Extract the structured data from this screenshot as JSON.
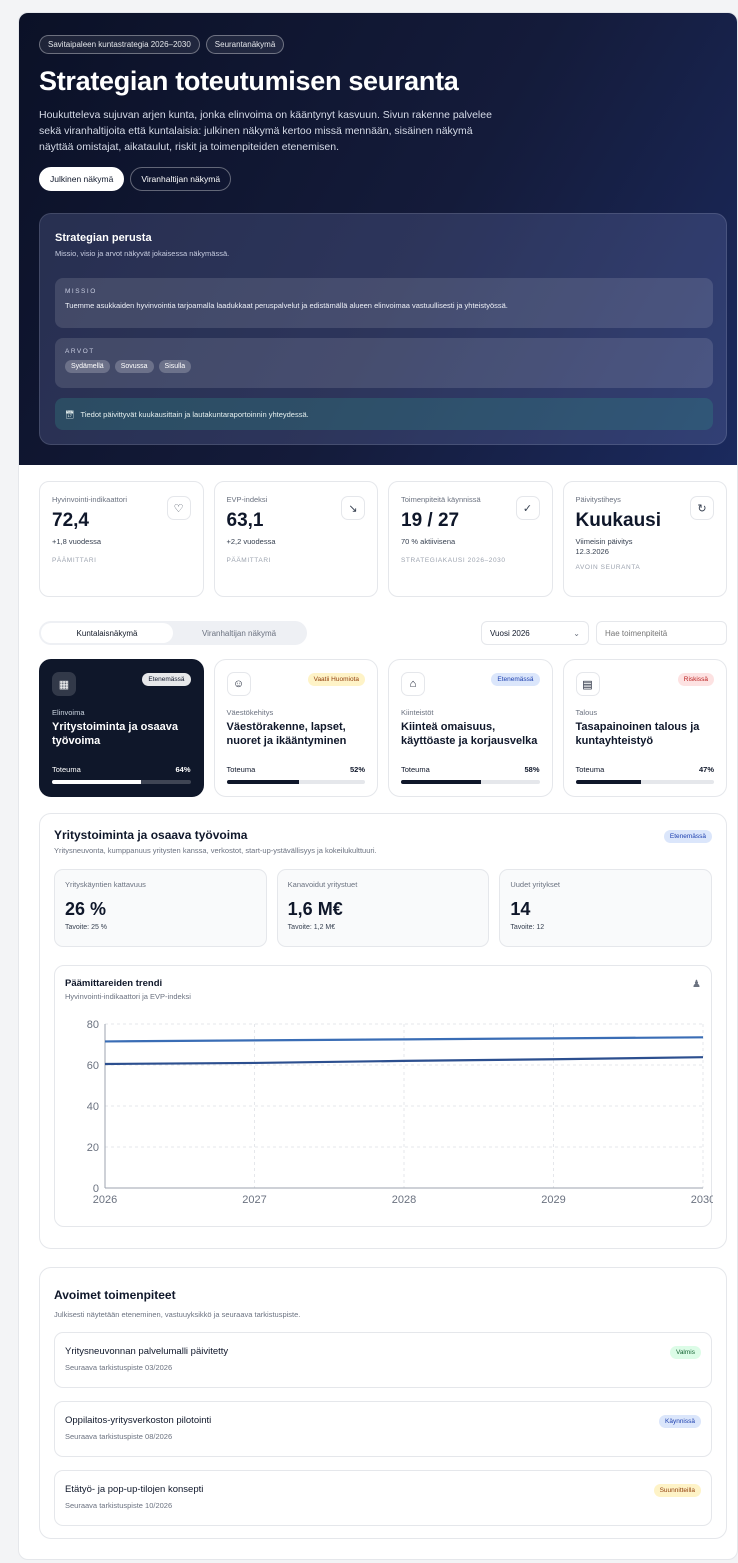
{
  "hero": {
    "pill1": "Savitaipaleen kuntastrategia 2026–2030",
    "pill2": "Seurantanäkymä",
    "title": "Strategian toteutumisen seuranta",
    "lead": "Houkutteleva sujuvan arjen kunta, jonka elinvoima on kääntynyt kasvuun. Sivun rakenne palvelee sekä viranhaltijoita että kuntalaisia: julkinen näkymä kertoo missä mennään, sisäinen näkymä näyttää omistajat, aikataulut, riskit ja toimenpiteiden etenemisen.",
    "toggle_public": "Julkinen näkymä",
    "toggle_official": "Viranhaltijan näkymä"
  },
  "foundation": {
    "title": "Strategian perusta",
    "sub": "Missio, visio ja arvot näkyvät jokaisessa näkymässä.",
    "mission_label": "MISSIO",
    "mission_text": "Tuemme asukkaiden hyvinvointia tarjoamalla laadukkaat peruspalvelut ja edistämällä alueen elinvoimaa vastuullisesti ja yhteistyössä.",
    "values_label": "ARVOT",
    "values": [
      "Sydämellä",
      "Sovussa",
      "Sisulla"
    ],
    "note": "Tiedot päivittyvät kuukausittain ja lautakuntaraportoinnin yhteydessä."
  },
  "kpis": [
    {
      "label": "Hyvinvointi-indikaattori",
      "value": "72,4",
      "delta": "+1,8 vuodessa",
      "foot": "PÄÄMITTARI",
      "icon": "heart-pulse-icon"
    },
    {
      "label": "EVP-indeksi",
      "value": "63,1",
      "delta": "+2,2 vuodessa",
      "foot": "PÄÄMITTARI",
      "icon": "line-chart-icon"
    },
    {
      "label": "Toimenpiteitä käynnissä",
      "value": "19 / 27",
      "delta": "70 % aktiivisena",
      "foot": "STRATEGIAKAUSI 2026–2030",
      "icon": "check-circle-icon"
    },
    {
      "label": "Päivitystiheys",
      "value": "Kuukausi",
      "delta": "Viimeisin päivitys 12.3.2026",
      "foot": "AVOIN SEURANTA",
      "icon": "refresh-icon"
    }
  ],
  "controls": {
    "seg_citizen": "Kuntalaisnäkymä",
    "seg_official": "Viranhaltijan näkymä",
    "year": "Vuosi 2026",
    "search_placeholder": "Hae toimenpiteitä"
  },
  "cards": [
    {
      "badge": "Etenemässä",
      "category": "Elinvoima",
      "title": "Yritystoiminta ja osaava työvoima",
      "progress_label": "Toteuma",
      "progress": "64%",
      "progress_value": 0.64,
      "icon": "building-icon"
    },
    {
      "badge": "Vaatii Huomiota",
      "category": "Väestökehitys",
      "title": "Väestörakenne, lapset, nuoret ja ikääntyminen",
      "progress_label": "Toteuma",
      "progress": "52%",
      "progress_value": 0.52,
      "icon": "users-icon"
    },
    {
      "badge": "Etenemässä",
      "category": "Kiinteistöt",
      "title": "Kiinteä omaisuus, käyttöaste ja korjausvelka",
      "progress_label": "Toteuma",
      "progress": "58%",
      "progress_value": 0.58,
      "icon": "home-icon"
    },
    {
      "badge": "Riskissä",
      "category": "Talous",
      "title": "Tasapainoinen talous ja kuntayhteistyö",
      "progress_label": "Toteuma",
      "progress": "47%",
      "progress_value": 0.47,
      "icon": "wallet-icon"
    }
  ],
  "detail": {
    "title": "Yritystoiminta ja osaava työvoima",
    "sub": "Yritysneuvonta, kumppanuus yritysten kanssa, verkostot, start-up-ystävällisyys ja kokeilukulttuuri.",
    "badge": "Etenemässä",
    "metrics": [
      {
        "label": "Yrityskäyntien kattavuus",
        "value": "26 %",
        "goal": "Tavoite: 25 %"
      },
      {
        "label": "Kanavoidut yritystuet",
        "value": "1,6 M€",
        "goal": "Tavoite: 1,2 M€"
      },
      {
        "label": "Uudet yritykset",
        "value": "14",
        "goal": "Tavoite: 12"
      }
    ]
  },
  "chart_data": {
    "type": "line",
    "title": "Päämittareiden trendi",
    "subtitle": "Hyvinvointi-indikaattori ja EVP-indeksi",
    "x": [
      "2026",
      "2027",
      "2028",
      "2029",
      "2030"
    ],
    "ylim": [
      0,
      80
    ],
    "yticks": [
      "0",
      "20",
      "40",
      "60",
      "80"
    ],
    "grid": true,
    "series": [
      {
        "values": [
          71.5,
          72,
          72.5,
          73,
          73.5
        ],
        "color": "#3a6db5"
      },
      {
        "values": [
          60.5,
          61,
          62,
          62.8,
          63.8
        ],
        "color": "#2c4f8f"
      }
    ]
  },
  "actions": {
    "title": "Avoimet toimenpiteet",
    "sub": "Julkisesti näytetään eteneminen, vastuuyksikkö ja seuraava tarkistuspiste.",
    "items": [
      {
        "name": "Yritysneuvonnan palvelumalli päivitetty",
        "checkpoint": "Seuraava tarkistuspiste 03/2026",
        "status": "Valmis"
      },
      {
        "name": "Oppilaitos-yritysverkoston pilotointi",
        "checkpoint": "Seuraava tarkistuspiste 08/2026",
        "status": "Käynnissä"
      },
      {
        "name": "Etätyö- ja pop-up-tilojen konsepti",
        "checkpoint": "Seuraava tarkistuspiste 10/2026",
        "status": "Suunnitteilla"
      }
    ]
  }
}
